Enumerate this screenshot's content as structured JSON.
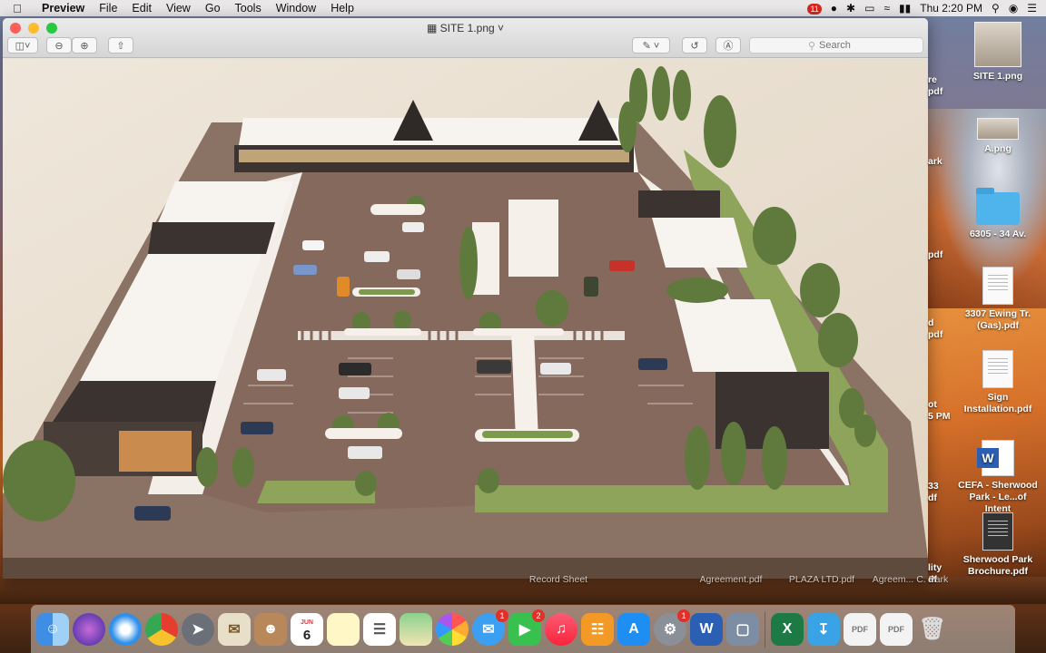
{
  "menubar": {
    "app_name": "Preview",
    "menus": [
      "File",
      "Edit",
      "View",
      "Go",
      "Tools",
      "Window",
      "Help"
    ],
    "notification_badge": "11",
    "clock": "Thu 2:20 PM"
  },
  "window": {
    "title": "SITE 1.png",
    "search_placeholder": "Search"
  },
  "desktop": {
    "icons": [
      {
        "label": "SITE 1.png"
      },
      {
        "label": "A.png"
      },
      {
        "label": "6305 - 34 Av."
      },
      {
        "label": "3307 Ewing Tr. (Gas).pdf"
      },
      {
        "label": "Sign Installation.pdf"
      },
      {
        "label": "CEFA - Sherwood Park - Le...of Intent"
      },
      {
        "label": "Sherwood Park Brochure.pdf"
      }
    ],
    "partial_labels": [
      "re",
      "pdf",
      "ark",
      "pdf",
      "d",
      "pdf",
      "ot",
      "5 PM",
      "33",
      "df",
      "lity",
      "df"
    ],
    "bottom_labels": [
      "Record Sheet",
      "Agreement.pdf",
      "PLAZA LTD.pdf",
      "Agreem... C. Park"
    ]
  },
  "dock": {
    "badges": {
      "messages": "1",
      "facetime": "2",
      "preferences": "1"
    },
    "calendar_month": "JUN",
    "calendar_day": "6"
  },
  "colors": {
    "accent": "#2b5fb3",
    "close": "#fc5f57",
    "minimize": "#fdbc2e",
    "maximize": "#28c840"
  }
}
